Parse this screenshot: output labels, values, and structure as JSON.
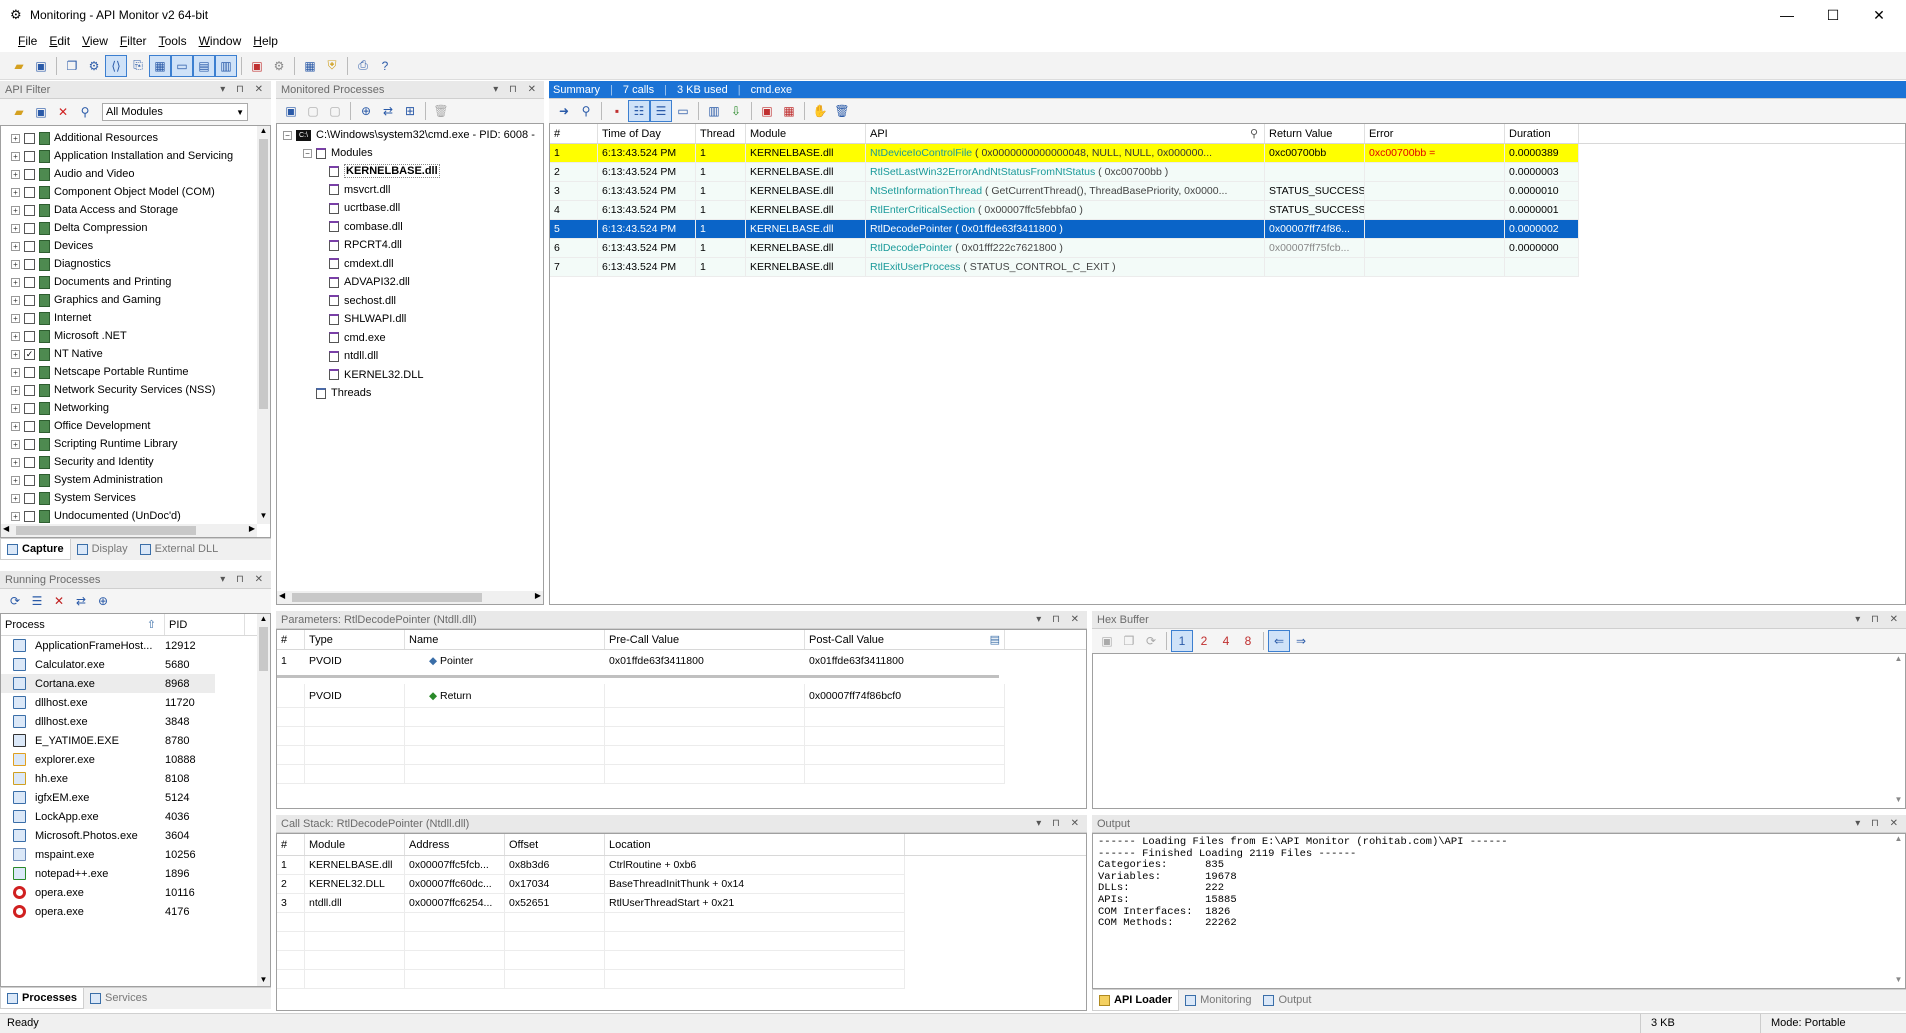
{
  "window": {
    "title": "Monitoring - API Monitor v2 64-bit",
    "minimize": "—",
    "maximize": "☐",
    "close": "✕"
  },
  "menu": [
    {
      "key": "F",
      "rest": "ile"
    },
    {
      "key": "E",
      "rest": "dit"
    },
    {
      "key": "V",
      "rest": "iew"
    },
    {
      "key": "F",
      "rest": "ilter"
    },
    {
      "key": "T",
      "rest": "ools"
    },
    {
      "key": "W",
      "rest": "indow"
    },
    {
      "key": "H",
      "rest": "elp"
    }
  ],
  "api_filter": {
    "title": "API Filter",
    "dropdown": "All Modules",
    "items": [
      {
        "label": "Additional Resources",
        "checked": false
      },
      {
        "label": "Application Installation and Servicing",
        "checked": false
      },
      {
        "label": "Audio and Video",
        "checked": false
      },
      {
        "label": "Component Object Model (COM)",
        "checked": false
      },
      {
        "label": "Data Access and Storage",
        "checked": false
      },
      {
        "label": "Delta Compression",
        "checked": false
      },
      {
        "label": "Devices",
        "checked": false
      },
      {
        "label": "Diagnostics",
        "checked": false
      },
      {
        "label": "Documents and Printing",
        "checked": false
      },
      {
        "label": "Graphics and Gaming",
        "checked": false
      },
      {
        "label": "Internet",
        "checked": false
      },
      {
        "label": "Microsoft .NET",
        "checked": false
      },
      {
        "label": "NT Native",
        "checked": true
      },
      {
        "label": "Netscape Portable Runtime",
        "checked": false
      },
      {
        "label": "Network Security Services (NSS)",
        "checked": false
      },
      {
        "label": "Networking",
        "checked": false
      },
      {
        "label": "Office Development",
        "checked": false
      },
      {
        "label": "Scripting Runtime Library",
        "checked": false
      },
      {
        "label": "Security and Identity",
        "checked": false
      },
      {
        "label": "System Administration",
        "checked": false
      },
      {
        "label": "System Services",
        "checked": false
      },
      {
        "label": "Undocumented (UnDoc'd)",
        "checked": false
      }
    ],
    "tabs": [
      "Capture",
      "Display",
      "External DLL"
    ]
  },
  "monitored": {
    "title": "Monitored Processes",
    "process": "C:\\Windows\\system32\\cmd.exe - PID: 6008 -",
    "modules_label": "Modules",
    "modules": [
      "KERNELBASE.dll",
      "msvcrt.dll",
      "ucrtbase.dll",
      "combase.dll",
      "RPCRT4.dll",
      "cmdext.dll",
      "ADVAPI32.dll",
      "sechost.dll",
      "SHLWAPI.dll",
      "cmd.exe",
      "ntdll.dll",
      "KERNEL32.DLL"
    ],
    "threads_label": "Threads"
  },
  "summary": {
    "tabs": [
      "Summary",
      "7 calls",
      "3 KB used",
      "cmd.exe"
    ],
    "columns": [
      "#",
      "Time of Day",
      "Thread",
      "Module",
      "API",
      "Return Value",
      "Error",
      "Duration"
    ],
    "rows": [
      {
        "n": "1",
        "time": "6:13:43.524 PM",
        "thread": "1",
        "module": "KERNELBASE.dll",
        "api_name": "NtDeviceIoControlFile",
        "api_args": " ( 0x0000000000000048, NULL, NULL, 0x000000...",
        "ret": "0xc00700bb",
        "err": "0xc00700bb =",
        "dur": "0.0000389"
      },
      {
        "n": "2",
        "time": "6:13:43.524 PM",
        "thread": "1",
        "module": "KERNELBASE.dll",
        "api_name": "RtlSetLastWin32ErrorAndNtStatusFromNtStatus",
        "api_args": " ( 0xc00700bb )",
        "ret": "",
        "err": "",
        "dur": "0.0000003"
      },
      {
        "n": "3",
        "time": "6:13:43.524 PM",
        "thread": "1",
        "module": "KERNELBASE.dll",
        "api_name": "NtSetInformationThread",
        "api_args": " ( GetCurrentThread(), ThreadBasePriority, 0x0000...",
        "ret": "STATUS_SUCCESS",
        "err": "",
        "dur": "0.0000010"
      },
      {
        "n": "4",
        "time": "6:13:43.524 PM",
        "thread": "1",
        "module": "KERNELBASE.dll",
        "api_name": "RtlEnterCriticalSection",
        "api_args": " ( 0x00007ffc5febbfa0 )",
        "ret": "STATUS_SUCCESS",
        "err": "",
        "dur": "0.0000001"
      },
      {
        "n": "5",
        "time": "6:13:43.524 PM",
        "thread": "1",
        "module": "KERNELBASE.dll",
        "api_name": "RtlDecodePointer",
        "api_args": " ( 0x01ffde63f3411800 )",
        "ret": "0x00007ff74f86...",
        "err": "",
        "dur": "0.0000002"
      },
      {
        "n": "6",
        "time": "6:13:43.524 PM",
        "thread": "1",
        "module": "KERNELBASE.dll",
        "api_name": "RtlDecodePointer",
        "api_args": " ( 0x01fff222c7621800 )",
        "ret": "0x00007ff75fcb...",
        "err": "",
        "dur": "0.0000000"
      },
      {
        "n": "7",
        "time": "6:13:43.524 PM",
        "thread": "1",
        "module": "KERNELBASE.dll",
        "api_name": "RtlExitUserProcess",
        "api_args": " ( STATUS_CONTROL_C_EXIT )",
        "ret": "",
        "err": "",
        "dur": ""
      }
    ]
  },
  "running": {
    "title": "Running Processes",
    "columns": [
      "Process",
      "PID"
    ],
    "rows": [
      {
        "name": "ApplicationFrameHost...",
        "pid": "12912"
      },
      {
        "name": "Calculator.exe",
        "pid": "5680"
      },
      {
        "name": "Cortana.exe",
        "pid": "8968"
      },
      {
        "name": "dllhost.exe",
        "pid": "11720"
      },
      {
        "name": "dllhost.exe",
        "pid": "3848"
      },
      {
        "name": "E_YATIM0E.EXE",
        "pid": "8780"
      },
      {
        "name": "explorer.exe",
        "pid": "10888"
      },
      {
        "name": "hh.exe",
        "pid": "8108"
      },
      {
        "name": "igfxEM.exe",
        "pid": "5124"
      },
      {
        "name": "LockApp.exe",
        "pid": "4036"
      },
      {
        "name": "Microsoft.Photos.exe",
        "pid": "3604"
      },
      {
        "name": "mspaint.exe",
        "pid": "10256"
      },
      {
        "name": "notepad++.exe",
        "pid": "1896"
      },
      {
        "name": "opera.exe",
        "pid": "10116"
      },
      {
        "name": "opera.exe",
        "pid": "4176"
      }
    ],
    "tabs": [
      "Processes",
      "Services"
    ]
  },
  "params": {
    "title": "Parameters: RtlDecodePointer (Ntdll.dll)",
    "columns": [
      "#",
      "Type",
      "Name",
      "Pre-Call Value",
      "Post-Call Value"
    ],
    "rows": [
      {
        "n": "1",
        "type": "PVOID",
        "name": "Pointer",
        "pre": "0x01ffde63f3411800",
        "post": "0x01ffde63f3411800"
      }
    ],
    "ret": {
      "type": "PVOID",
      "name": "Return",
      "post": "0x00007ff74f86bcf0"
    }
  },
  "hex": {
    "title": "Hex Buffer",
    "buttons": [
      "1",
      "2",
      "4",
      "8"
    ]
  },
  "callstack": {
    "title": "Call Stack: RtlDecodePointer (Ntdll.dll)",
    "columns": [
      "#",
      "Module",
      "Address",
      "Offset",
      "Location"
    ],
    "rows": [
      {
        "n": "1",
        "module": "KERNELBASE.dll",
        "addr": "0x00007ffc5fcb...",
        "off": "0x8b3d6",
        "loc": "CtrlRoutine + 0xb6"
      },
      {
        "n": "2",
        "module": "KERNEL32.DLL",
        "addr": "0x00007ffc60dc...",
        "off": "0x17034",
        "loc": "BaseThreadInitThunk + 0x14"
      },
      {
        "n": "3",
        "module": "ntdll.dll",
        "addr": "0x00007ffc6254...",
        "off": "0x52651",
        "loc": "RtlUserThreadStart + 0x21"
      }
    ]
  },
  "output": {
    "title": "Output",
    "lines": [
      "------ Loading Files from E:\\API Monitor (rohitab.com)\\API ------",
      "------ Finished Loading 2119 Files ------",
      "Categories:      835",
      "Variables:       19678",
      "DLLs:            222",
      "APIs:            15885",
      "COM Interfaces:  1826",
      "COM Methods:     22262"
    ],
    "tabs": [
      "API Loader",
      "Monitoring",
      "Output"
    ]
  },
  "status": {
    "left": "Ready",
    "size": "3 KB",
    "mode": "Mode: Portable"
  },
  "colors": {
    "highlight": "#ffff00",
    "selected": "#0a64c8",
    "api_link": "#1a9a9a",
    "error_red": "#e00000"
  }
}
